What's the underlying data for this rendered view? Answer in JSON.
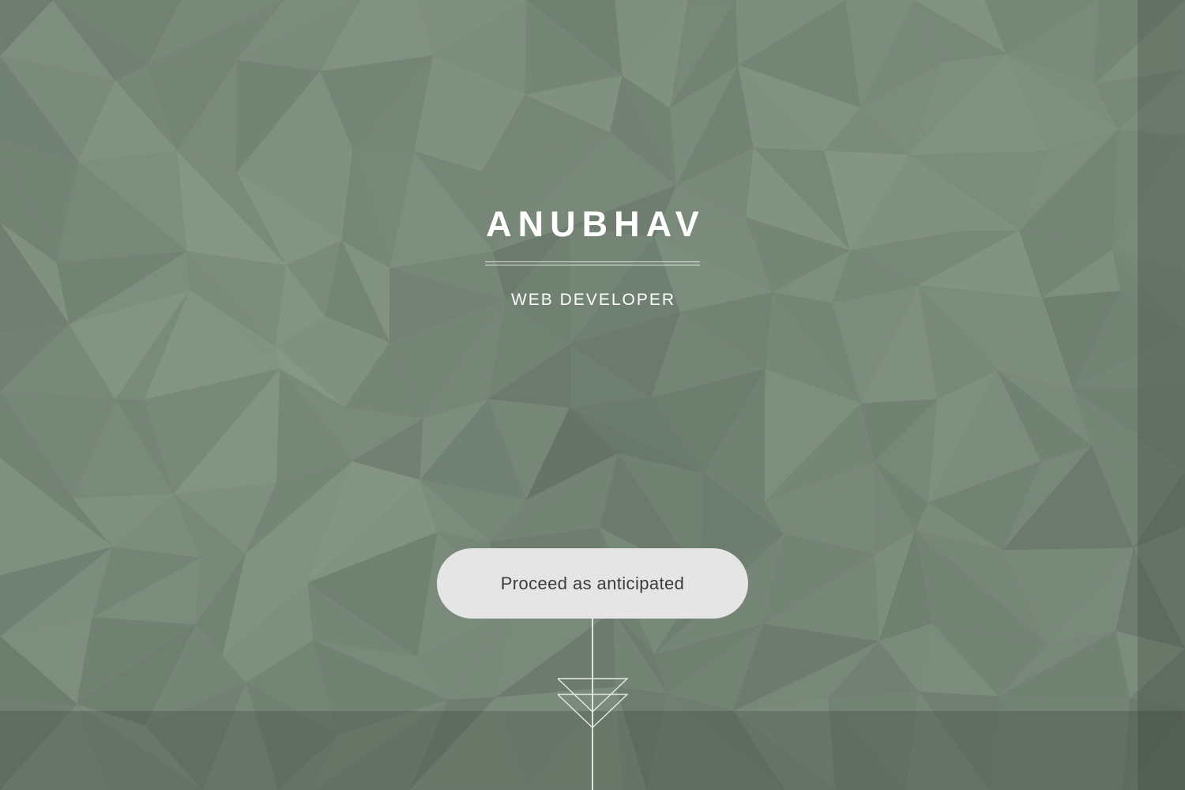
{
  "hero": {
    "title": "ANUBHAV",
    "subtitle": "WEB DEVELOPER"
  },
  "cta": {
    "label": "Proceed as anticipated"
  },
  "scroll_indicator": {
    "icon": "double-chevron-down-icon"
  },
  "colors": {
    "background": "#66776a",
    "text": "#ffffff",
    "button_bg": "#e4e5e4",
    "button_text": "#3a3d3b"
  }
}
